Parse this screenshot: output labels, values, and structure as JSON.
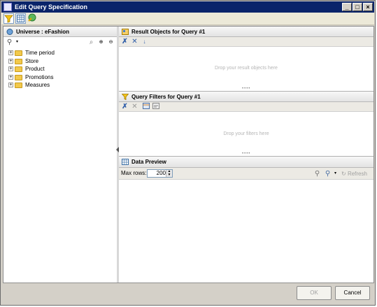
{
  "window": {
    "title": "Edit Query Specification"
  },
  "universe_panel": {
    "title": "Universe : eFashion",
    "tree": [
      {
        "label": "Time period"
      },
      {
        "label": "Store"
      },
      {
        "label": "Product"
      },
      {
        "label": "Promotions"
      },
      {
        "label": "Measures"
      }
    ]
  },
  "result_panel": {
    "title": "Result Objects for Query #1",
    "placeholder": "Drop your result objects here"
  },
  "filter_panel": {
    "title": "Query Filters for Query #1",
    "placeholder": "Drop your filters here"
  },
  "preview_panel": {
    "title": "Data Preview",
    "max_rows_label": "Max rows:",
    "max_rows_value": "200",
    "refresh_label": "Refresh"
  },
  "footer": {
    "ok_label": "OK",
    "cancel_label": "Cancel"
  }
}
